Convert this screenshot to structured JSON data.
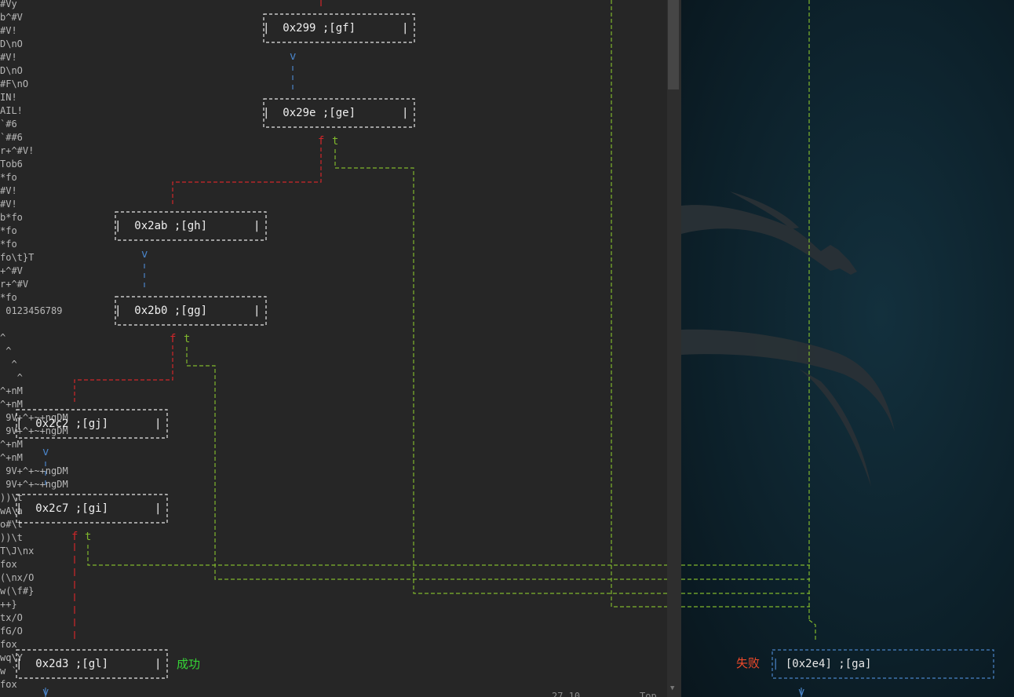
{
  "garbage_lines": [
    "#Vy",
    "b^#V",
    "#V!",
    "D\\nO",
    "#V!",
    "D\\nO",
    "#F\\nO",
    "IN!",
    "AIL!",
    "`#6",
    "`##6",
    "r+^#V!",
    "Tob6",
    "*fo",
    "#V!",
    "#V!",
    "b*fo",
    "*fo",
    "*fo",
    "fo\\t}T",
    "+^#V",
    "r+^#V",
    "*fo",
    " 0123456789",
    "",
    "^",
    " ^",
    "  ^",
    "   ^",
    "^+nM",
    "^+nM",
    " 9V+^+~+ngDM",
    " 9V+^+~+ngDM",
    "^+nM",
    "^+nM",
    " 9V+^+~+ngDM",
    " 9V+^+~+ngDM",
    "))\\t",
    "wA\\a",
    "o#\\t",
    "))\\t",
    "T\\J\\nx",
    "fox",
    "(\\nx/O",
    "w(\\f#}",
    "++}",
    "tx/O",
    "fG/O",
    "fox",
    "wq\\Y",
    "w `",
    "fox"
  ],
  "nodes": {
    "n299": "0x299 ;[gf]",
    "n29e": "0x29e ;[ge]",
    "n2ab": "0x2ab ;[gh]",
    "n2b0": "0x2b0 ;[gg]",
    "n2c2": "0x2c2 ;[gj]",
    "n2c7": "0x2c7 ;[gi]",
    "n2d3": "0x2d3 ;[gl]",
    "n2e4": "[0x2e4] ;[ga]"
  },
  "edge_labels": {
    "false": "f",
    "true": "t",
    "next": "v"
  },
  "annotations": {
    "success": "成功",
    "failure": "失败"
  },
  "status_bar": {
    "position": "27,10",
    "scroll": "Top"
  },
  "colors": {
    "false_edge": "#d0262a",
    "true_edge": "#7fb62c",
    "next_edge": "#4a84c8",
    "box": "#e8e8e8",
    "failure_box": "#4a84c8"
  }
}
